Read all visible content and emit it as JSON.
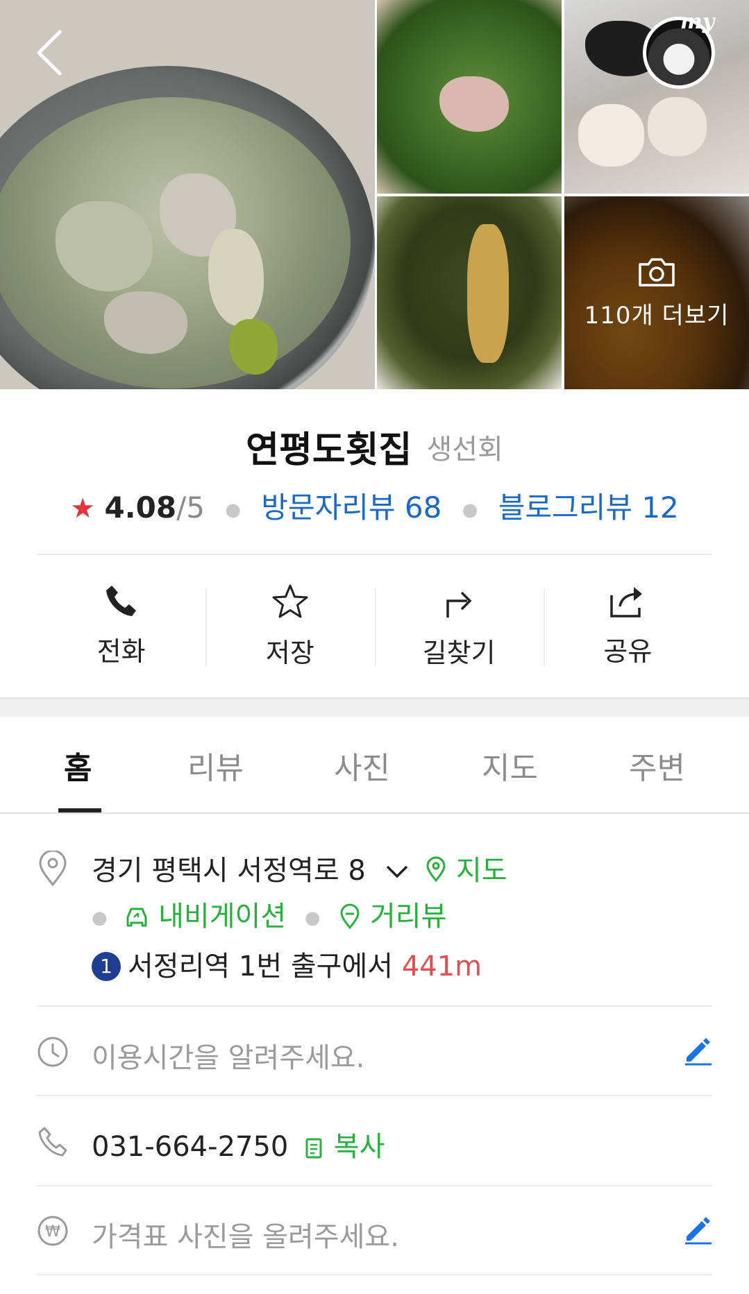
{
  "gallery": {
    "more_label": "110개 더보기",
    "my_badge_text": "my"
  },
  "place": {
    "name": "연평도횟집",
    "category": "생선회",
    "rating": "4.08",
    "rating_max": "/5",
    "visitor_reviews": "방문자리뷰 68",
    "blog_reviews": "블로그리뷰 12"
  },
  "actions": [
    {
      "label": "전화",
      "icon": "phone-icon"
    },
    {
      "label": "저장",
      "icon": "star-outline-icon"
    },
    {
      "label": "길찾기",
      "icon": "directions-arrow-icon"
    },
    {
      "label": "공유",
      "icon": "share-icon"
    }
  ],
  "tabs": [
    "홈",
    "리뷰",
    "사진",
    "지도",
    "주변"
  ],
  "active_tab": "홈",
  "info": {
    "address": "경기 평택시 서정역로 8",
    "map_link": "지도",
    "navigation_link": "내비게이션",
    "streetview_link": "거리뷰",
    "subway_line": "1",
    "subway_text": "서정리역 1번 출구에서",
    "subway_distance": "441m",
    "hours_placeholder": "이용시간을 알려주세요.",
    "phone": "031-664-2750",
    "copy_label": "복사",
    "price_placeholder": "가격표 사진을 올려주세요."
  },
  "colors": {
    "accent_green": "#27b13c",
    "link_blue": "#1a68c7",
    "star_red": "#e8323c",
    "subway_line1": "#1f3e93",
    "distance_red": "#e05050"
  }
}
